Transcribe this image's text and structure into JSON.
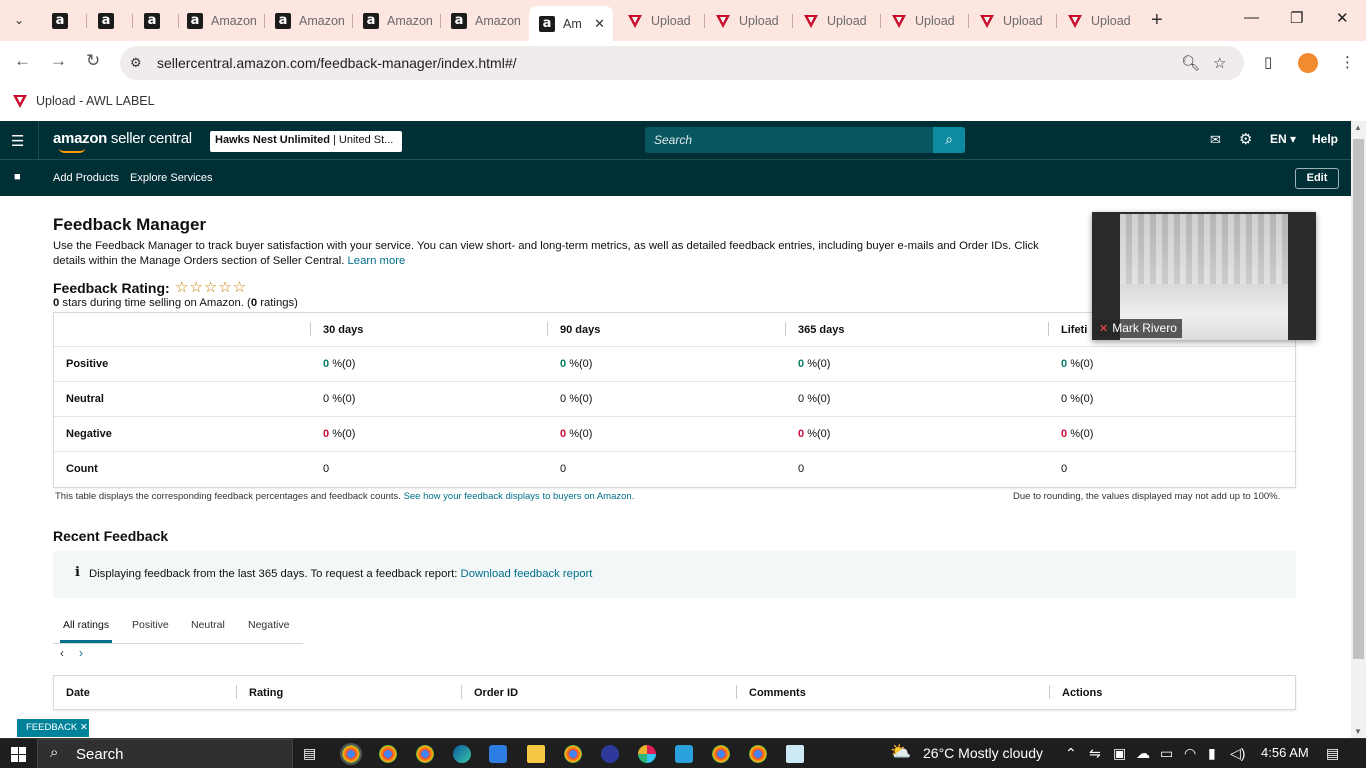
{
  "browser": {
    "tabs": [
      {
        "kind": "amazon",
        "label": ""
      },
      {
        "kind": "amazon",
        "label": ""
      },
      {
        "kind": "amazon",
        "label": ""
      },
      {
        "kind": "amazon",
        "label": "Amazon"
      },
      {
        "kind": "amazon",
        "label": "Amazon"
      },
      {
        "kind": "amazon",
        "label": "Amazon"
      },
      {
        "kind": "amazon",
        "label": "Amazon"
      },
      {
        "kind": "amazon",
        "label": "Am",
        "active": true
      },
      {
        "kind": "upload",
        "label": "Upload"
      },
      {
        "kind": "upload",
        "label": "Upload"
      },
      {
        "kind": "upload",
        "label": "Upload"
      },
      {
        "kind": "upload",
        "label": "Upload"
      },
      {
        "kind": "upload",
        "label": "Upload"
      },
      {
        "kind": "upload",
        "label": "Upload"
      }
    ],
    "url": "sellercentral.amazon.com/feedback-manager/index.html#/",
    "bookmark": "Upload - AWL LABEL"
  },
  "header": {
    "logo_strong": "amazon",
    "logo_rest": " seller central",
    "store_name": "Hawks Nest Unlimited",
    "store_region": " | United St...",
    "search_placeholder": "Search",
    "language": "EN",
    "help": "Help"
  },
  "subnav": {
    "links": [
      "Add Products",
      "Explore Services"
    ],
    "edit": "Edit"
  },
  "page": {
    "title": "Feedback Manager",
    "intro": "Use the Feedback Manager to track buyer satisfaction with your service. You can view short- and long-term metrics, as well as detailed feedback entries, including buyer e-mails and Order IDs. Click",
    "intro_line2": "details within the Manage Orders section of Seller Central.",
    "learn_more": "Learn more",
    "rating_label": "Feedback Rating:",
    "stars": "☆☆☆☆☆",
    "rating_count": "0",
    "rating_text": " stars during time selling on Amazon. (",
    "rating_ratings": "0",
    "rating_text_end": " ratings)"
  },
  "feedback_table": {
    "columns": [
      "30 days",
      "90 days",
      "365 days",
      "Lifeti"
    ],
    "rows": [
      {
        "label": "Positive",
        "values": [
          "0",
          "0",
          "0",
          "0"
        ],
        "suffix": "%(0)"
      },
      {
        "label": "Neutral",
        "values": [
          "0",
          "0",
          "0",
          "0"
        ],
        "suffix": "%(0)"
      },
      {
        "label": "Negative",
        "values": [
          "0",
          "0",
          "0",
          "0"
        ],
        "suffix": "%(0)"
      },
      {
        "label": "Count",
        "values": [
          "0",
          "0",
          "0",
          "0"
        ],
        "suffix": ""
      }
    ],
    "note_left": "This table displays the corresponding feedback percentages and feedback counts.",
    "note_link": "See how your feedback displays to buyers on Amazon.",
    "note_right": "Due to rounding, the values displayed may not add up to 100%."
  },
  "recent": {
    "title": "Recent Feedback",
    "info_icon": "i",
    "info_text": "Displaying feedback from the last 365 days. To request a feedback report:",
    "info_link": "Download feedback report",
    "tabs": [
      "All ratings",
      "Positive",
      "Neutral",
      "Negative"
    ],
    "columns": [
      "Date",
      "Rating",
      "Order ID",
      "Comments",
      "Actions"
    ]
  },
  "video": {
    "participant": "Mark Rivero"
  },
  "feedback_pill": "FEEDBACK ✕",
  "taskbar": {
    "search": "Search",
    "weather": "26°C  Mostly cloudy",
    "time": "4:56 AM"
  },
  "colors": {
    "header": "#002f36",
    "accent": "#00708a",
    "positive": "#067d62",
    "negative": "#cc0c39"
  }
}
